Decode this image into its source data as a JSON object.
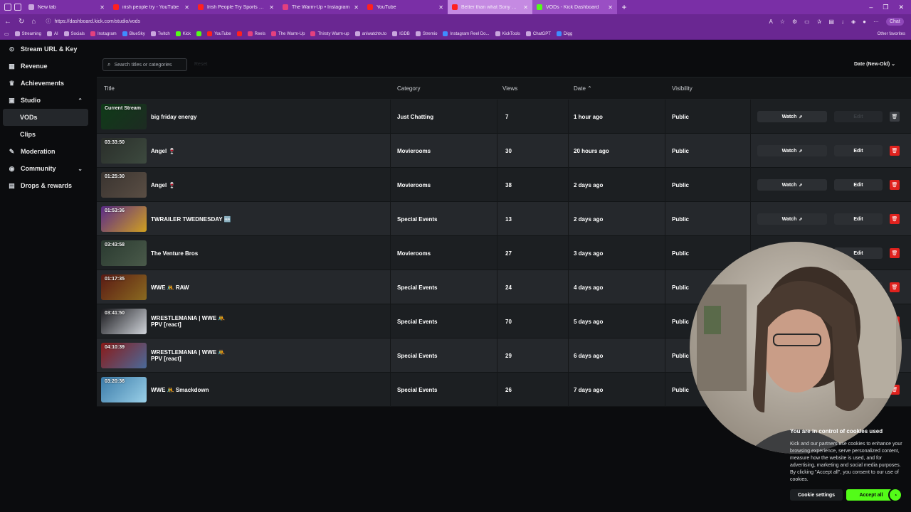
{
  "browser": {
    "tabs": [
      {
        "title": "New tab",
        "icon": "newtab-icon",
        "color": "#c9a6dd"
      },
      {
        "title": "irish people try - YouTube",
        "icon": "youtube-icon",
        "color": "#ff2020"
      },
      {
        "title": "Irish People Try Sports Celebrity A...",
        "icon": "youtube-icon",
        "color": "#ff2020"
      },
      {
        "title": "The Warm-Up • Instagram",
        "icon": "instagram-icon",
        "color": "#e4407e"
      },
      {
        "title": "YouTube",
        "icon": "youtube-icon",
        "color": "#ff2020"
      },
      {
        "title": "Better than what Sony made - Sup...",
        "icon": "youtube-icon",
        "color": "#ff2020"
      },
      {
        "title": "VODs - Kick Dashboard",
        "icon": "kick-icon",
        "color": "#53fc18"
      }
    ],
    "new_tab_label": "+",
    "url": "https://dashboard.kick.com/studio/vods",
    "copilot_label": "Chat",
    "bookmarks": [
      {
        "label": "Streaming",
        "color": "#c9a6dd"
      },
      {
        "label": "AI",
        "color": "#c9a6dd"
      },
      {
        "label": "Socials",
        "color": "#c9a6dd"
      },
      {
        "label": "Instagram",
        "color": "#e4407e"
      },
      {
        "label": "BlueSky",
        "color": "#3f8cff"
      },
      {
        "label": "Twitch",
        "color": "#c9a6dd"
      },
      {
        "label": "Kick",
        "color": "#53fc18"
      },
      {
        "label": "",
        "color": "#53fc18"
      },
      {
        "label": "YouTube",
        "color": "#ff2020"
      },
      {
        "label": "",
        "color": "#ff2020"
      },
      {
        "label": "Reels",
        "color": "#e4407e"
      },
      {
        "label": "The Warm-Up",
        "color": "#e4407e"
      },
      {
        "label": "Thirsty Warm-up",
        "color": "#e4407e"
      },
      {
        "label": "aniwatchtv.to",
        "color": "#c9a6dd"
      },
      {
        "label": "IGDB",
        "color": "#c9a6dd"
      },
      {
        "label": "Stremio",
        "color": "#c9a6dd"
      },
      {
        "label": "Instagram Reel Do...",
        "color": "#3f8cff"
      },
      {
        "label": "KickTools",
        "color": "#c9a6dd"
      },
      {
        "label": "ChatGPT",
        "color": "#c9a6dd"
      },
      {
        "label": "Digg",
        "color": "#3f8cff"
      }
    ],
    "other_favorites": "Other favorites"
  },
  "sidebar": {
    "items": [
      {
        "label": "Stream URL & Key",
        "icon": "key-icon"
      },
      {
        "label": "Revenue",
        "icon": "revenue-icon"
      },
      {
        "label": "Achievements",
        "icon": "trophy-icon"
      },
      {
        "label": "Studio",
        "icon": "studio-icon",
        "expanded": true
      },
      {
        "label": "VODs",
        "sub": true,
        "active": true
      },
      {
        "label": "Clips",
        "sub": true
      },
      {
        "label": "Moderation",
        "icon": "wrench-icon"
      },
      {
        "label": "Community",
        "icon": "community-icon",
        "expanded": false
      },
      {
        "label": "Drops & rewards",
        "icon": "gift-icon"
      }
    ]
  },
  "toolbar": {
    "search_placeholder": "Search titles or categories",
    "reset_label": "Reset",
    "sort_label": "Date (New-Old)"
  },
  "table": {
    "headers": {
      "title": "Title",
      "category": "Category",
      "views": "Views",
      "date": "Date",
      "visibility": "Visibility"
    },
    "watch_label": "Watch",
    "edit_label": "Edit",
    "rows": [
      {
        "duration": "Current Stream",
        "title": "big friday energy",
        "category": "Just Chatting",
        "views": "7",
        "date": "1 hour ago",
        "visibility": "Public",
        "thumb": [
          "#0f3b18",
          "#1d2b22"
        ],
        "live": true
      },
      {
        "duration": "03:33:50",
        "title": "Angel 🍷",
        "category": "Movierooms",
        "views": "30",
        "date": "20 hours ago",
        "visibility": "Public",
        "thumb": [
          "#2a2e2a",
          "#3d4a3f"
        ]
      },
      {
        "duration": "01:25:30",
        "title": "Angel 🍷",
        "category": "Movierooms",
        "views": "38",
        "date": "2 days ago",
        "visibility": "Public",
        "thumb": [
          "#3a3430",
          "#5a4e44"
        ]
      },
      {
        "duration": "01:53:36",
        "title": "TWRAILER TWEDNESDAY 🆕",
        "category": "Special Events",
        "views": "13",
        "date": "2 days ago",
        "visibility": "Public",
        "thumb": [
          "#5a2a8a",
          "#d0a020"
        ]
      },
      {
        "duration": "03:43:58",
        "title": "The Venture Bros",
        "category": "Movierooms",
        "views": "27",
        "date": "3 days ago",
        "visibility": "Public",
        "thumb": [
          "#2a3a30",
          "#4a5a4a"
        ]
      },
      {
        "duration": "01:17:35",
        "title": "WWE 🤼 RAW",
        "category": "Special Events",
        "views": "24",
        "date": "4 days ago",
        "visibility": "Public",
        "thumb": [
          "#5a1a14",
          "#8a6a20"
        ]
      },
      {
        "duration": "03:41:50",
        "title": "WRESTLEMANIA | WWE 🤼 PPV [react]",
        "category": "Special Events",
        "views": "70",
        "date": "5 days ago",
        "visibility": "Public",
        "thumb": [
          "#1a1a1e",
          "#d0d4da"
        ]
      },
      {
        "duration": "04:10:39",
        "title": "WRESTLEMANIA | WWE 🤼 PPV [react]",
        "category": "Special Events",
        "views": "29",
        "date": "6 days ago",
        "visibility": "Public",
        "thumb": [
          "#8a1a18",
          "#4a6a9a"
        ]
      },
      {
        "duration": "03:20:36",
        "title": "WWE 🤼 Smackdown",
        "category": "Special Events",
        "views": "26",
        "date": "7 days ago",
        "visibility": "Public",
        "thumb": [
          "#3a7aa8",
          "#9ad0e8"
        ]
      }
    ]
  },
  "cookie_banner": {
    "heading": "You are in control of cookies used",
    "body": "Kick and our partners use cookies to enhance your browsing experience, serve personalized content, measure how the website is used, and for advertising, marketing and social media purposes. By clicking \"Accept all\", you consent to our use of cookies.",
    "settings_label": "Cookie settings",
    "accept_label": "Accept all"
  },
  "colors": {
    "accent": "#53fc18",
    "browser_frame": "#6a2792",
    "delete": "#e0221e",
    "background": "#0b0c0e"
  }
}
